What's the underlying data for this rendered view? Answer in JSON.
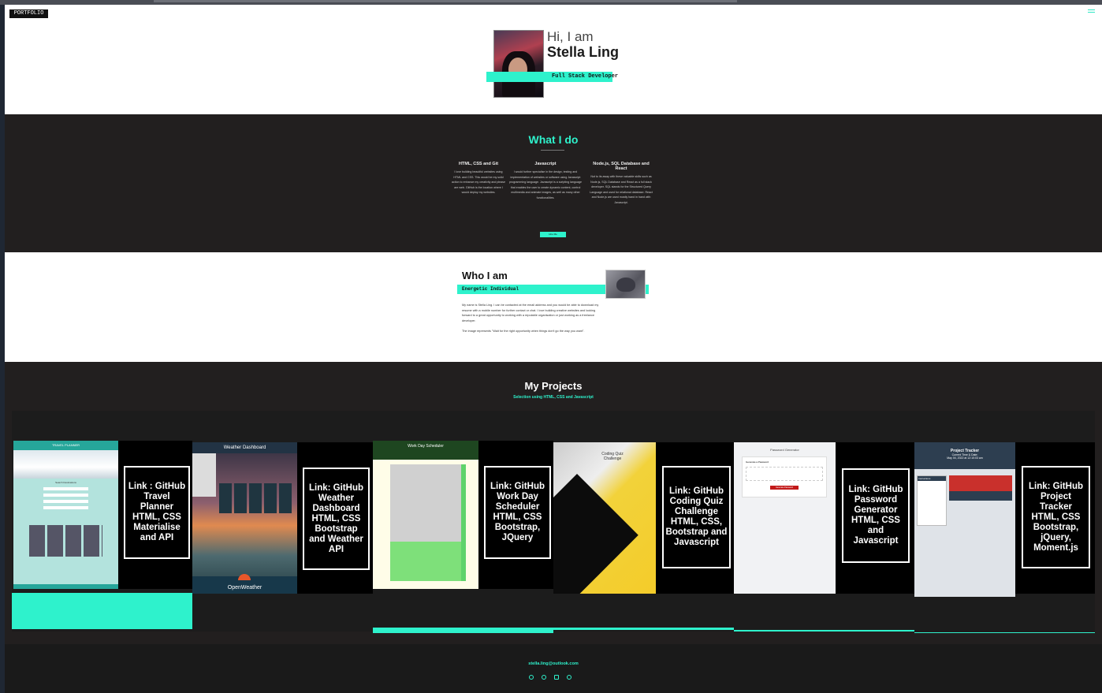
{
  "header": {
    "logo": "PORTFOLIO",
    "greeting": "Hi, I am",
    "name": "Stella Ling",
    "role": "Full Stack Developer"
  },
  "what_i_do": {
    "title": "What I do",
    "columns": [
      {
        "title": "HTML, CSS and Git",
        "text": "I love building beautiful websites using HTML and CSS. This would be my solid action to enhance my creativity and please are web. GitHub is the location where I would deploy my websites."
      },
      {
        "title": "Javascript",
        "text": "I would further specialise in the design, testing and implementation of websites or software using Javascript programming language. Javascript is a scripting language that enables the user to create dynamic content, control multimedia and animate images, as well as many other functionalities."
      },
      {
        "title": "Node.js, SQL Database and React",
        "text": "Not to its away with these valuable skills such as Node.js, SQL Database and React as a full stack developer. SQL stands for the Structured Query Language and used for relational database. React and Node.js are used mostly hand in hand with Javascript."
      }
    ],
    "button": "Hire Me"
  },
  "who_i_am": {
    "title": "Who I am",
    "subtitle": "Energetic Individual",
    "paragraph1": "My name is Stella Ling. I can be contacted at the email address and you would be able to download my resume with a mobile number for further contact or chat. I love building creative websites and looking forward to a great opportunity to working with a reputable organisation or just working as a freelance developer.",
    "paragraph2": "The image represents \"Wait for the right opportunity when things don't go the way you want\"."
  },
  "projects": {
    "title": "My Projects",
    "subtitle": "Selection using HTML, CSS and Javascript",
    "items": [
      {
        "link": "Link : GitHub Travel Planner HTML, CSS Materialise and API",
        "app_title": "TRAVEL PLANNER",
        "app_section": "Search Destinations"
      },
      {
        "link": "Link: GitHub Weather Dashboard HTML, CSS Bootstrap and Weather API",
        "app_title": "Weather Dashboard",
        "app_footer": "OpenWeather"
      },
      {
        "link": "Link: GitHub Work Day Scheduler HTML, CSS Bootstrap, JQuery",
        "app_title": "Work Day Scheduler"
      },
      {
        "link": "Link: GitHub Coding Quiz Challenge HTML, CSS, Bootstrap and Javascript",
        "app_title": "Coding Quiz Challenge"
      },
      {
        "link": "Link: GitHub Password Generator HTML, CSS and Javascript",
        "app_title": "Password Generator",
        "app_field": "Generate a Password",
        "app_button": "Generate Password"
      },
      {
        "link": "Link: GitHub Project Tracker HTML, CSS Bootstrap, jQuery, Moment.js",
        "app_title": "Project Tracker",
        "app_subtitle": "Current Time & Date:",
        "app_date": "May 04, 2022 at 12:10:03 am",
        "app_section": "Instructions"
      }
    ]
  },
  "footer": {
    "email": "stella.ling@outlook.com",
    "icons": [
      "globe-icon",
      "dribbble-icon",
      "linkedin-icon",
      "github-icon"
    ]
  },
  "colors": {
    "accent": "#2ef2cc",
    "dark": "#221f1f",
    "light": "#ffffff"
  }
}
